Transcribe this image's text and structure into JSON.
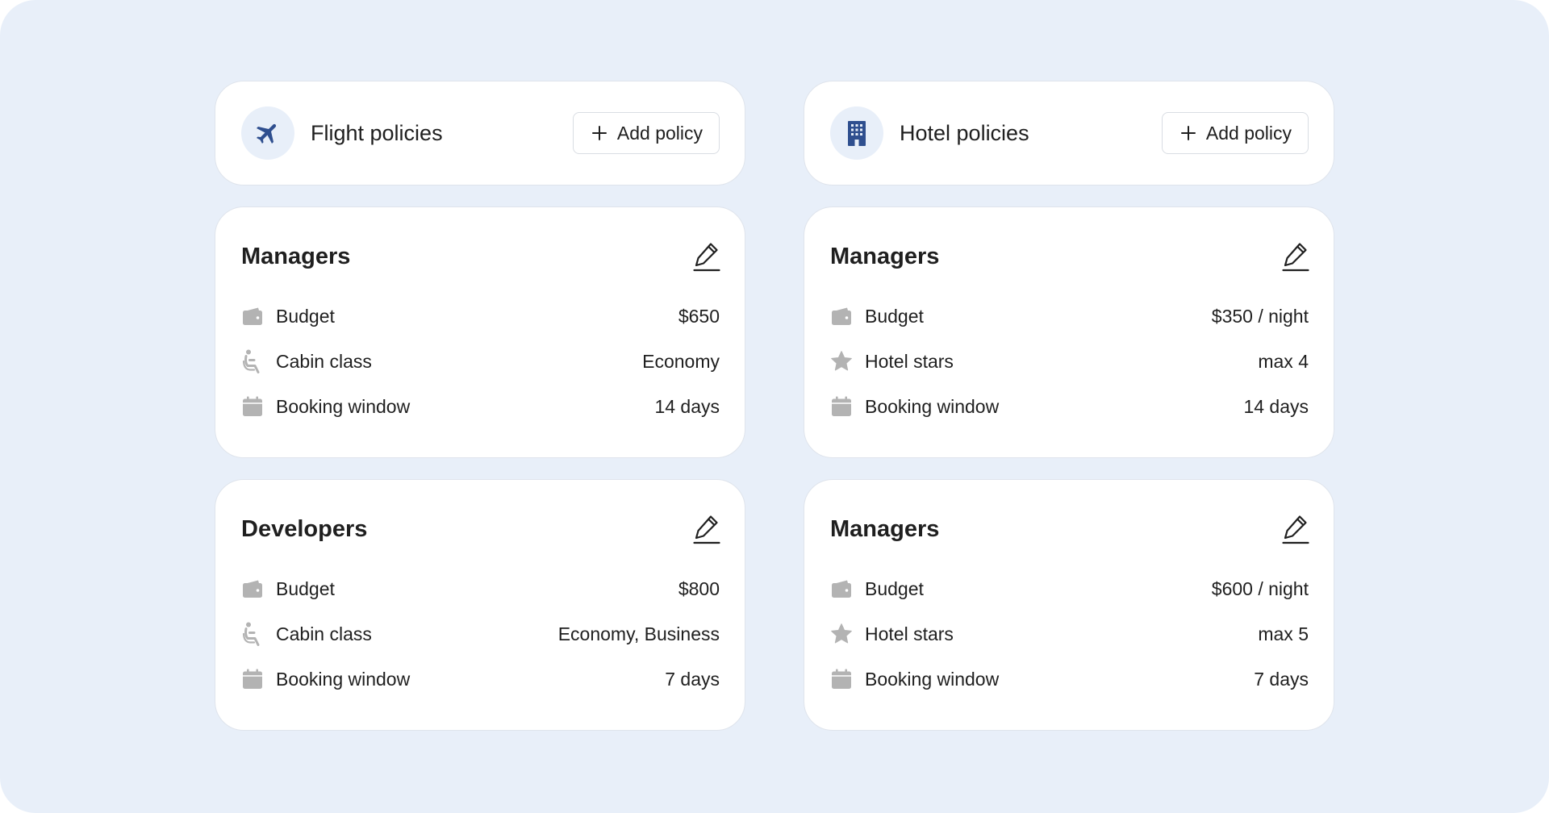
{
  "colors": {
    "background": "#e8eff9",
    "accent": "#2f4f8f",
    "icon_muted": "#b3b3b3"
  },
  "categories": [
    {
      "title": "Flight policies",
      "icon": "airplane-icon",
      "add_label": "Add policy",
      "policies": [
        {
          "name": "Managers",
          "rows": [
            {
              "icon": "wallet-icon",
              "label": "Budget",
              "value": "$650"
            },
            {
              "icon": "seat-icon",
              "label": "Cabin class",
              "value": "Economy"
            },
            {
              "icon": "calendar-icon",
              "label": "Booking window",
              "value": "14 days"
            }
          ]
        },
        {
          "name": "Developers",
          "rows": [
            {
              "icon": "wallet-icon",
              "label": "Budget",
              "value": "$800"
            },
            {
              "icon": "seat-icon",
              "label": "Cabin class",
              "value": "Economy, Business"
            },
            {
              "icon": "calendar-icon",
              "label": "Booking window",
              "value": "7 days"
            }
          ]
        }
      ]
    },
    {
      "title": "Hotel policies",
      "icon": "building-icon",
      "add_label": "Add policy",
      "policies": [
        {
          "name": "Managers",
          "rows": [
            {
              "icon": "wallet-icon",
              "label": "Budget",
              "value": "$350 / night"
            },
            {
              "icon": "star-icon",
              "label": "Hotel stars",
              "value": "max 4"
            },
            {
              "icon": "calendar-icon",
              "label": "Booking window",
              "value": "14 days"
            }
          ]
        },
        {
          "name": "Managers",
          "rows": [
            {
              "icon": "wallet-icon",
              "label": "Budget",
              "value": "$600 / night"
            },
            {
              "icon": "star-icon",
              "label": "Hotel stars",
              "value": "max 5"
            },
            {
              "icon": "calendar-icon",
              "label": "Booking window",
              "value": "7 days"
            }
          ]
        }
      ]
    }
  ]
}
